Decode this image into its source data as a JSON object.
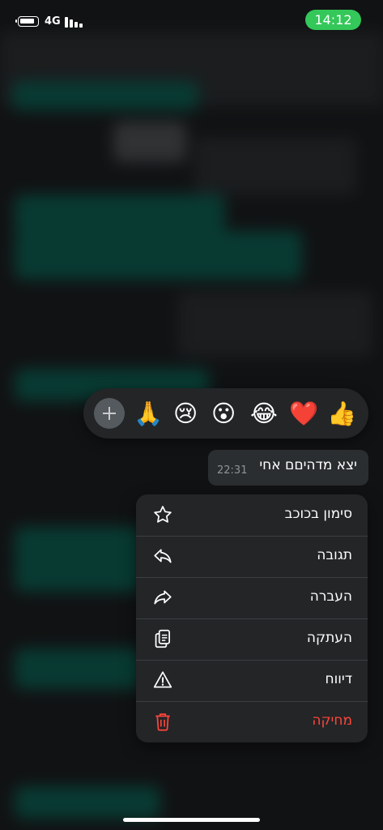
{
  "status_bar": {
    "network": "4G",
    "time": "14:12"
  },
  "reactions": [
    {
      "name": "thumbs-up-emoji",
      "glyph": "👍"
    },
    {
      "name": "red-heart-emoji",
      "glyph": "❤️"
    },
    {
      "name": "tears-of-joy-emoji",
      "glyph": "😂"
    },
    {
      "name": "surprised-emoji",
      "glyph": "😮"
    },
    {
      "name": "crying-emoji",
      "glyph": "😢"
    },
    {
      "name": "folded-hands-emoji",
      "glyph": "🙏"
    }
  ],
  "message": {
    "text": "יצא מדהיםם אחי",
    "time": "22:31"
  },
  "menu": {
    "star": "סימון בכוכב",
    "reply": "תגובה",
    "forward": "העברה",
    "copy": "העתקה",
    "report": "דיווח",
    "delete": "מחיקה"
  },
  "colors": {
    "accent": "#34c759",
    "danger": "#ff453a",
    "menu_bg": "#232527"
  }
}
